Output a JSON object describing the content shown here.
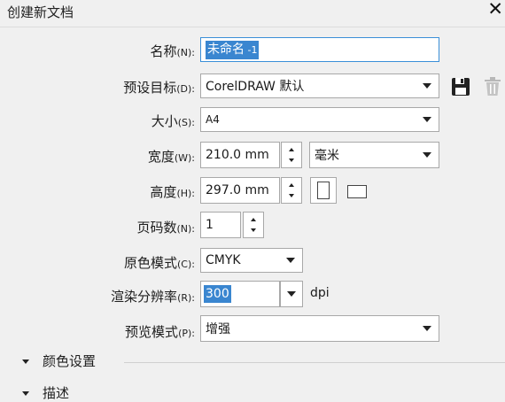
{
  "window": {
    "title": "创建新文档",
    "close_glyph": "✕"
  },
  "form": {
    "name": {
      "label": "名称",
      "key": "(N):",
      "value_main": "未命名",
      "value_suffix": " -1"
    },
    "preset": {
      "label": "预设目标",
      "key": "(D):",
      "value": "CorelDRAW 默认"
    },
    "size": {
      "label": "大小",
      "key": "(S):",
      "value": "A4"
    },
    "width": {
      "label": "宽度",
      "key": "(W):",
      "value": "210.0 mm",
      "unit": "毫米"
    },
    "height": {
      "label": "高度",
      "key": "(H):",
      "value": "297.0 mm"
    },
    "pages": {
      "label": "页码数",
      "key": "(N):",
      "value": "1"
    },
    "color_mode": {
      "label": "原色模式",
      "key": "(C):",
      "value": "CMYK"
    },
    "resolution": {
      "label": "渲染分辨率",
      "key": "(R):",
      "value": "300",
      "unit": "dpi"
    },
    "preview": {
      "label": "预览模式",
      "key": "(P):",
      "value": "增强"
    }
  },
  "sections": {
    "color_settings": "颜色设置",
    "description": "描述"
  },
  "icons": {
    "save": "save-preset-icon",
    "delete": "delete-preset-icon",
    "portrait": "portrait-orientation-icon",
    "landscape": "landscape-orientation-icon"
  },
  "colors": {
    "selection": "#3a86d0",
    "focus_border": "#3a8fd8"
  }
}
